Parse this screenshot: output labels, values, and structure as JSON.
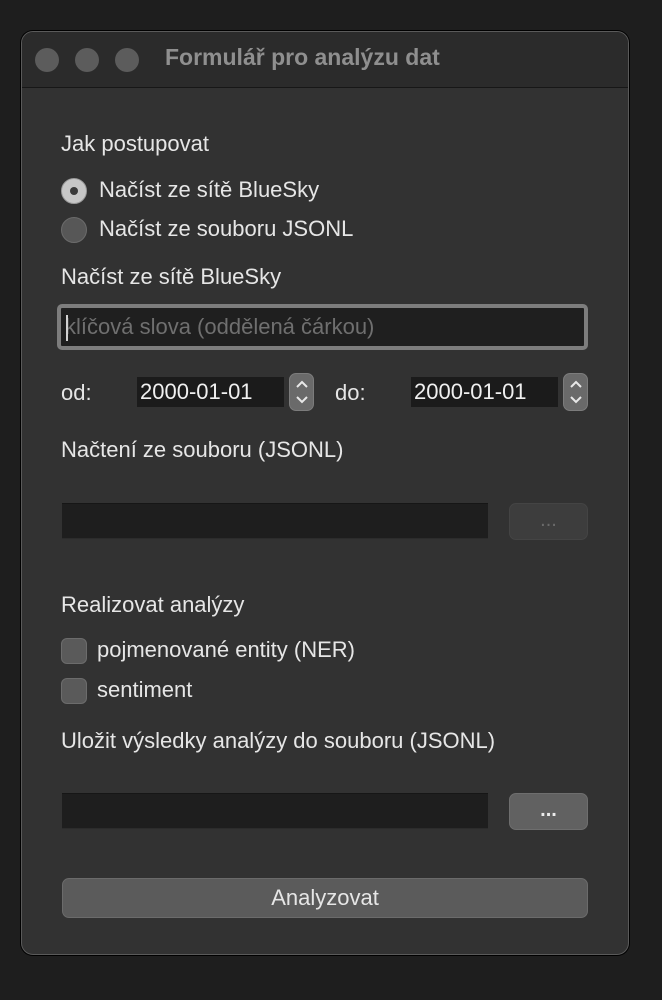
{
  "window": {
    "title": "Formulář pro analýzu dat"
  },
  "mode": {
    "heading": "Jak postupovat",
    "options": [
      {
        "label": "Načíst ze sítě BlueSky",
        "selected": true
      },
      {
        "label": "Načíst ze souboru JSONL",
        "selected": false
      }
    ]
  },
  "bluesky": {
    "heading": "Načíst ze sítě BlueSky",
    "keywords_placeholder": "klíčová slova (oddělená čárkou)",
    "keywords_value": "",
    "from_label": "od:",
    "from_value": "2000-01-01",
    "to_label": "do:",
    "to_value": "2000-01-01"
  },
  "file_input": {
    "heading": "Načtení ze souboru (JSONL)",
    "path": "",
    "browse_label": "..."
  },
  "analyses": {
    "heading": "Realizovat analýzy",
    "options": [
      {
        "label": "pojmenované entity (NER)",
        "checked": false
      },
      {
        "label": "sentiment",
        "checked": false
      }
    ]
  },
  "output": {
    "heading": "Uložit výsledky analýzy do souboru (JSONL)",
    "path": "",
    "browse_label": "..."
  },
  "actions": {
    "analyze_label": "Analyzovat"
  }
}
